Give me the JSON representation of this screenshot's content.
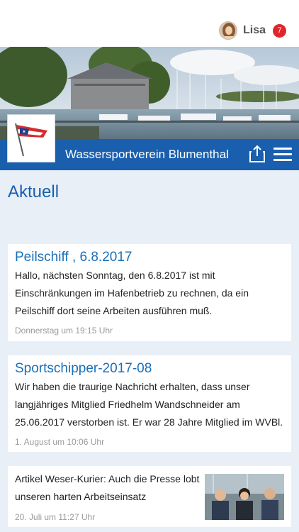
{
  "header": {
    "user": {
      "name": "Lisa",
      "notifications": "7"
    },
    "club_title": "Wassersportverein Blumenthal"
  },
  "page": {
    "title": "Aktuell"
  },
  "posts": [
    {
      "title": "Peilschiff , 6.8.2017",
      "text": "Hallo, nächsten Sonntag, den 6.8.2017 ist mit Einschränkungen im Hafenbetrieb zu rechnen, da ein Peilschiff dort seine Arbeiten ausführen muß.",
      "time": "Donnerstag um 19:15 Uhr"
    },
    {
      "title": "Sportschipper-2017-08",
      "text": "Wir haben die traurige Nachricht erhalten, dass unser langjähriges Mitglied Friedhelm Wandschneider am 25.06.2017 verstorben ist. Er war 28 Jahre Mitglied im WVBl.",
      "time": "1. August um 10:06 Uhr"
    },
    {
      "text": "Artikel Weser-Kurier: Auch die Presse lobt unseren harten Arbeitseinsatz",
      "time": "20. Juli um 11:27 Uhr"
    }
  ],
  "colors": {
    "brand_blue": "#1a5fae",
    "badge_red": "#e0262b",
    "background": "#e9eff6"
  },
  "icons": [
    "share-icon",
    "hamburger-menu-icon",
    "club-flag-logo",
    "user-avatar"
  ]
}
